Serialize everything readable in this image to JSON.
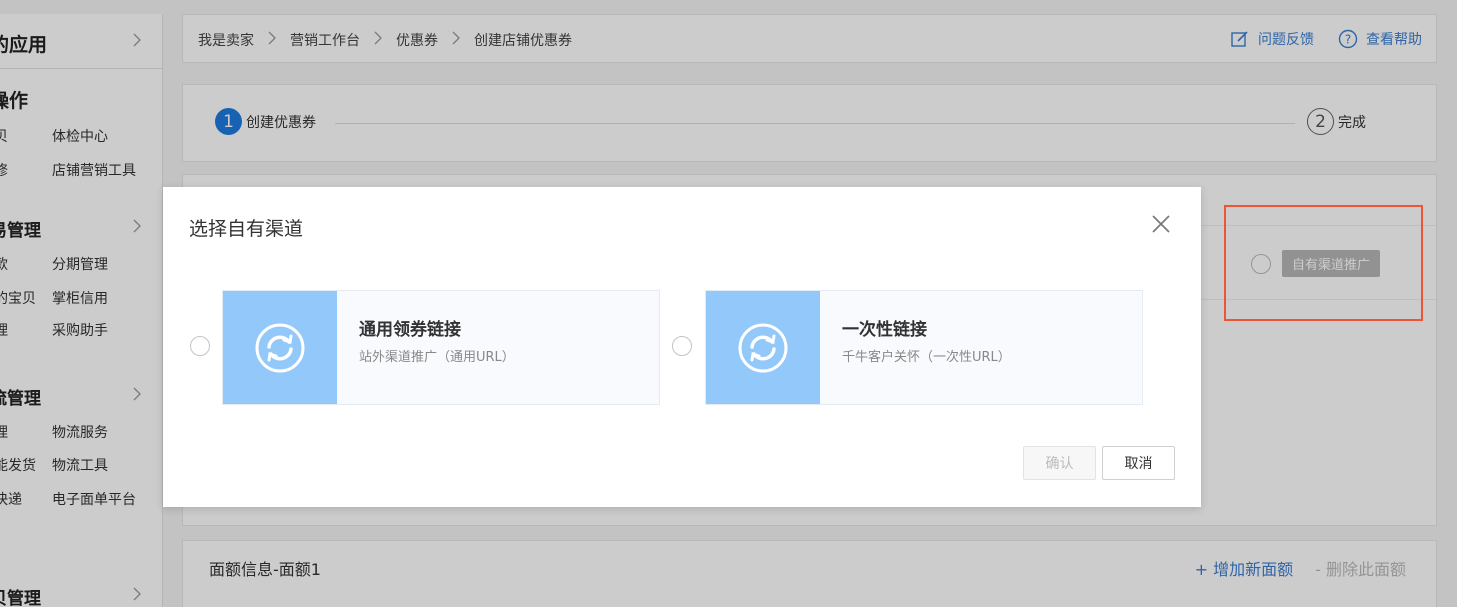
{
  "sidebar": {
    "my_apps": "的应用",
    "operations_title": "操作",
    "operations_items": [
      [
        "贝",
        "体检中心"
      ],
      [
        "修",
        "店铺营销工具"
      ]
    ],
    "trade_title": "易管理",
    "trade_items": [
      [
        "款",
        "分期管理"
      ],
      [
        "的宝贝",
        "掌柜信用"
      ],
      [
        "理",
        "采购助手"
      ]
    ],
    "logistics_title": "流管理",
    "logistics_items": [
      [
        "理",
        "物流服务"
      ],
      [
        "能发货",
        "物流工具"
      ],
      [
        "快递",
        "电子面单平台"
      ]
    ],
    "bottom_title": "贝管理"
  },
  "breadcrumb": {
    "items": [
      "我是卖家",
      "营销工作台",
      "优惠券",
      "创建店铺优惠券"
    ],
    "feedback": "问题反馈",
    "help": "查看帮助"
  },
  "steps": {
    "step1_num": "1",
    "step1_label": "创建优惠券",
    "step2_num": "2",
    "step2_label": "完成"
  },
  "form": {
    "own_channel_tag": "自有渠道推广"
  },
  "amount": {
    "title": "面额信息-面额1",
    "add": "+ 增加新面额",
    "delete": "- 删除此面额"
  },
  "modal": {
    "title": "选择自有渠道",
    "options": [
      {
        "title": "通用领券链接",
        "desc": "站外渠道推广（通用URL）"
      },
      {
        "title": "一次性链接",
        "desc": "千牛客户关怀（一次性URL）"
      }
    ],
    "confirm": "确认",
    "cancel": "取消"
  },
  "colors": {
    "accent_blue": "#1f7be0",
    "link_blue": "#3b7fd0",
    "thumb_blue": "#93c8fb",
    "highlight_red": "#ee5533"
  }
}
